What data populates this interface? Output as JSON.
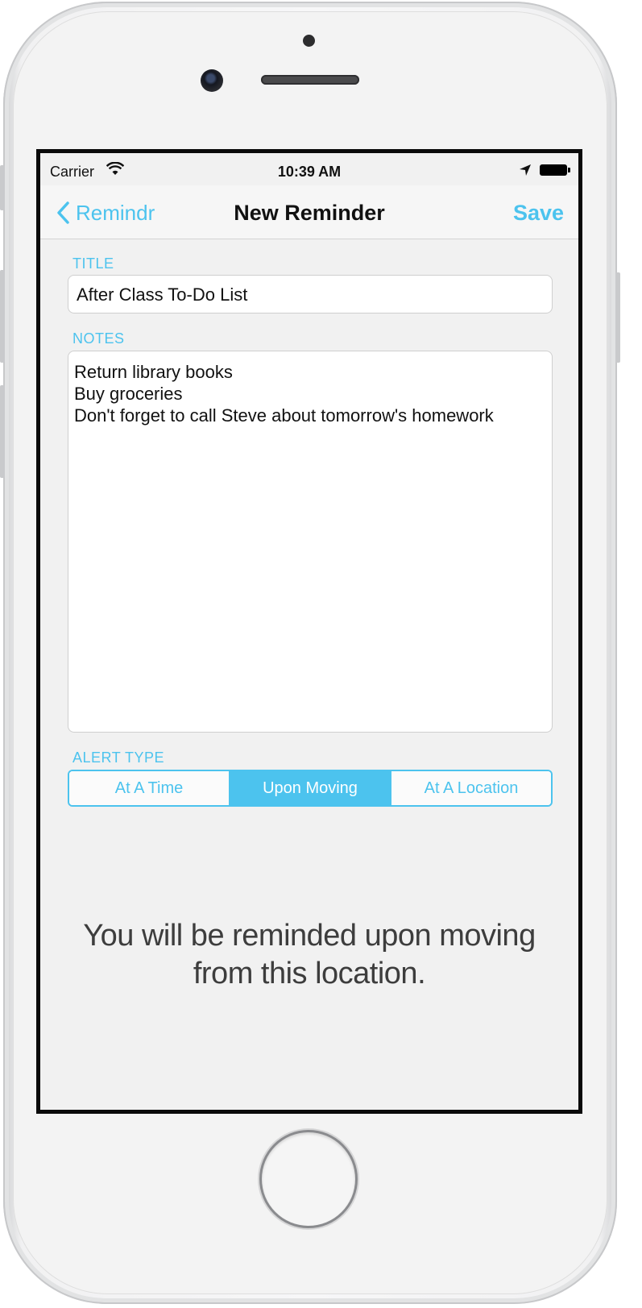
{
  "status_bar": {
    "carrier": "Carrier",
    "time": "10:39 AM",
    "icons": [
      "wifi-icon",
      "location-arrow-icon",
      "battery-icon"
    ]
  },
  "nav": {
    "back_label": "Remindr",
    "title": "New Reminder",
    "save_label": "Save"
  },
  "form": {
    "title_label": "TITLE",
    "title_value": "After Class To-Do List",
    "notes_label": "NOTES",
    "notes_lines": [
      "Return library books",
      "Buy groceries",
      "Don't forget to call Steve about tomorrow's homework"
    ],
    "alert_type_label": "ALERT TYPE",
    "alert_types": [
      "At A Time",
      "Upon Moving",
      "At A Location"
    ],
    "selected_alert_type": "Upon Moving"
  },
  "alert_message": {
    "line1": "You will be reminded upon moving",
    "line2": "from this location."
  },
  "colors": {
    "accent": "#4cc3ee",
    "background": "#f1f1f1",
    "text": "#111111"
  }
}
